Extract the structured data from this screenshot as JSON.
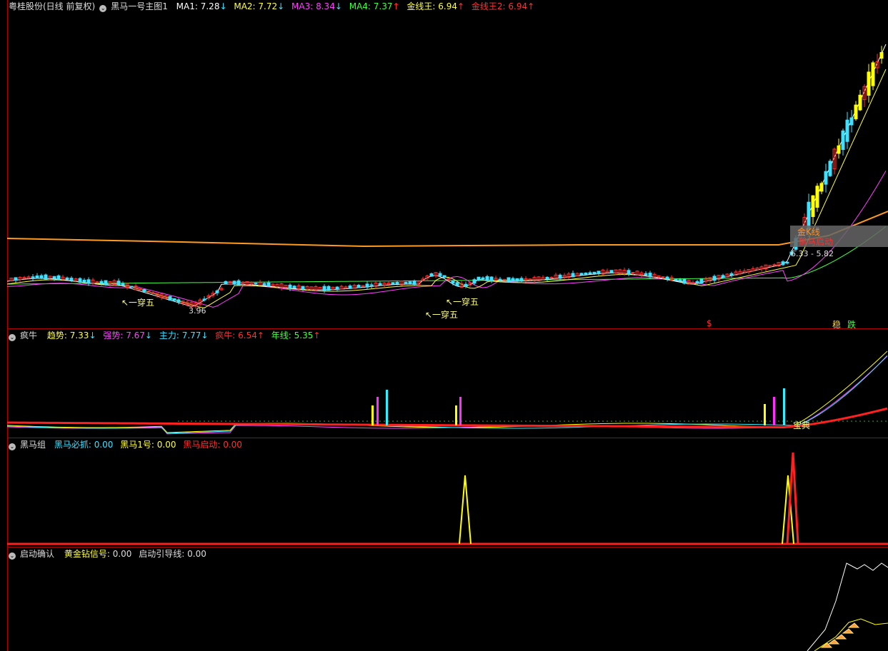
{
  "panel1": {
    "title": "粤桂股份(日线 前复权)",
    "indicator": "黑马一号主图1",
    "ma1_label": "MA1:",
    "ma1_value": "7.28",
    "ma1_arrow": "↓",
    "ma2_label": "MA2:",
    "ma2_value": "7.72",
    "ma2_arrow": "↓",
    "ma3_label": "MA3:",
    "ma3_value": "8.34",
    "ma3_arrow": "↓",
    "ma4_label": "MA4:",
    "ma4_value": "7.37",
    "ma4_arrow": "↑",
    "jxw_label": "金线王:",
    "jxw_value": "6.94",
    "jxw_arrow": "↑",
    "jxw2_label": "金线王2:",
    "jxw2_value": "6.94",
    "jxw2_arrow": "↑",
    "annot_low": "3.96",
    "annot_cy1": "↖一穿五",
    "annot_cy2": "↖一穿五",
    "annot_cy3": "↖一穿五",
    "annot_range": "6.33 - 5.82",
    "annot_start": "黑马启动",
    "annot_jk": "金K线",
    "annot_dollar": "$",
    "annot_wen": "稳",
    "annot_die": "跌"
  },
  "panel2": {
    "name": "疯牛",
    "qs_label": "趋势:",
    "qs_value": "7.33",
    "qs_arrow": "↓",
    "qiang_label": "强势:",
    "qiang_value": "7.67",
    "qiang_arrow": "↓",
    "zl_label": "主力:",
    "zl_value": "7.77",
    "zl_arrow": "↓",
    "fn_label": "疯牛:",
    "fn_value": "6.54",
    "fn_arrow": "↑",
    "nx_label": "年线:",
    "nx_value": "5.35",
    "nx_arrow": "↑",
    "annot_baodian": "宝典"
  },
  "panel3": {
    "name": "黑马组",
    "bz_label": "黑马必抓:",
    "bz_value": "0.00",
    "h1_label": "黑马1号:",
    "h1_value": "0.00",
    "qd_label": "黑马启动:",
    "qd_value": "0.00"
  },
  "panel4": {
    "name": "启动确认",
    "hj_label": "黄金钻信号:",
    "hj_value": "0.00",
    "yd_label": "启动引导线:",
    "yd_value": "0.00"
  },
  "colors": {
    "bg": "#000000",
    "border": "#b00000",
    "up": "#ff3030",
    "down": "#40e0ff",
    "ma1": "#ffffff",
    "ma2": "#ffff40",
    "ma3": "#ff40ff",
    "ma4": "#40ff40",
    "gold": "#ff9a20",
    "yellow": "#ffff00",
    "red": "#ff2020",
    "magenta": "#ff30ff",
    "cyan": "#30f0ff"
  }
}
